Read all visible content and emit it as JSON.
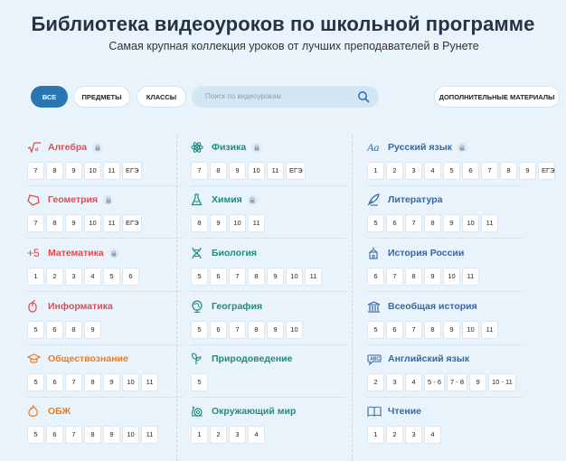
{
  "header": {
    "title": "Библиотека видеоуроков по школьной программе",
    "subtitle": "Самая крупная коллекция уроков от лучших преподавателей в Рунете"
  },
  "filters": {
    "all": "ВСЕ",
    "subjects": "ПРЕДМЕТЫ",
    "classes": "КЛАССЫ",
    "search_placeholder": "Поиск по видеоурокам",
    "extra": "ДОПОЛНИТЕЛЬНЫЕ МАТЕРИАЛЫ"
  },
  "colors": {
    "red": "#e14a52",
    "orange": "#ec7b1f",
    "teal": "#1f8a7e",
    "blue": "#3567a6",
    "accent": "#2a76b3"
  },
  "columns": [
    {
      "subjects": [
        {
          "name": "Алгебра",
          "icon": "sqrt-icon",
          "locked": true,
          "grades": [
            "7",
            "8",
            "9",
            "10",
            "11",
            "ЕГЭ"
          ]
        },
        {
          "name": "Геометрия",
          "icon": "polygon-icon",
          "locked": true,
          "grades": [
            "7",
            "8",
            "9",
            "10",
            "11",
            "ЕГЭ"
          ]
        },
        {
          "name": "Математика",
          "icon": "plus-five-icon",
          "locked": true,
          "grades": [
            "1",
            "2",
            "3",
            "4",
            "5",
            "6"
          ]
        },
        {
          "name": "Информатика",
          "icon": "mouse-icon",
          "locked": false,
          "grades": [
            "5",
            "6",
            "8",
            "9"
          ]
        },
        {
          "name": "Обществознание",
          "icon": "graduation-cap-icon",
          "locked": false,
          "grades": [
            "5",
            "6",
            "7",
            "8",
            "9",
            "10",
            "11"
          ]
        },
        {
          "name": "ОБЖ",
          "icon": "fire-icon",
          "locked": false,
          "grades": [
            "5",
            "6",
            "7",
            "8",
            "9",
            "10",
            "11"
          ]
        }
      ]
    },
    {
      "subjects": [
        {
          "name": "Физика",
          "icon": "atom-icon",
          "locked": true,
          "grades": [
            "7",
            "8",
            "9",
            "10",
            "11",
            "ЕГЭ"
          ]
        },
        {
          "name": "Химия",
          "icon": "flask-icon",
          "locked": true,
          "grades": [
            "8",
            "9",
            "10",
            "11"
          ]
        },
        {
          "name": "Биология",
          "icon": "dna-icon",
          "locked": false,
          "grades": [
            "5",
            "6",
            "7",
            "8",
            "9",
            "10",
            "11"
          ]
        },
        {
          "name": "География",
          "icon": "globe-icon",
          "locked": false,
          "grades": [
            "5",
            "6",
            "7",
            "8",
            "9",
            "10"
          ]
        },
        {
          "name": "Природоведение",
          "icon": "plant-icon",
          "locked": false,
          "grades": [
            "5"
          ]
        },
        {
          "name": "Окружающий мир",
          "icon": "snail-icon",
          "locked": false,
          "grades": [
            "1",
            "2",
            "3",
            "4"
          ]
        }
      ]
    },
    {
      "subjects": [
        {
          "name": "Русский язык",
          "icon": "letters-icon",
          "locked": true,
          "grades": [
            "1",
            "2",
            "3",
            "4",
            "5",
            "6",
            "7",
            "8",
            "9",
            "ЕГЭ"
          ]
        },
        {
          "name": "Литература",
          "icon": "quill-icon",
          "locked": false,
          "grades": [
            "5",
            "6",
            "7",
            "8",
            "9",
            "10",
            "11"
          ]
        },
        {
          "name": "История России",
          "icon": "church-icon",
          "locked": false,
          "grades": [
            "6",
            "7",
            "8",
            "9",
            "10",
            "11"
          ]
        },
        {
          "name": "Всеобщая история",
          "icon": "columns-icon",
          "locked": false,
          "grades": [
            "5",
            "6",
            "7",
            "8",
            "9",
            "10",
            "11"
          ]
        },
        {
          "name": "Английский язык",
          "icon": "speech-bubble-icon",
          "locked": false,
          "grades": [
            "2",
            "3",
            "4",
            "5 - 6",
            "7 - 8",
            "9",
            "10 - 11"
          ]
        },
        {
          "name": "Чтение",
          "icon": "book-icon",
          "locked": false,
          "grades": [
            "1",
            "2",
            "3",
            "4"
          ]
        }
      ]
    }
  ]
}
